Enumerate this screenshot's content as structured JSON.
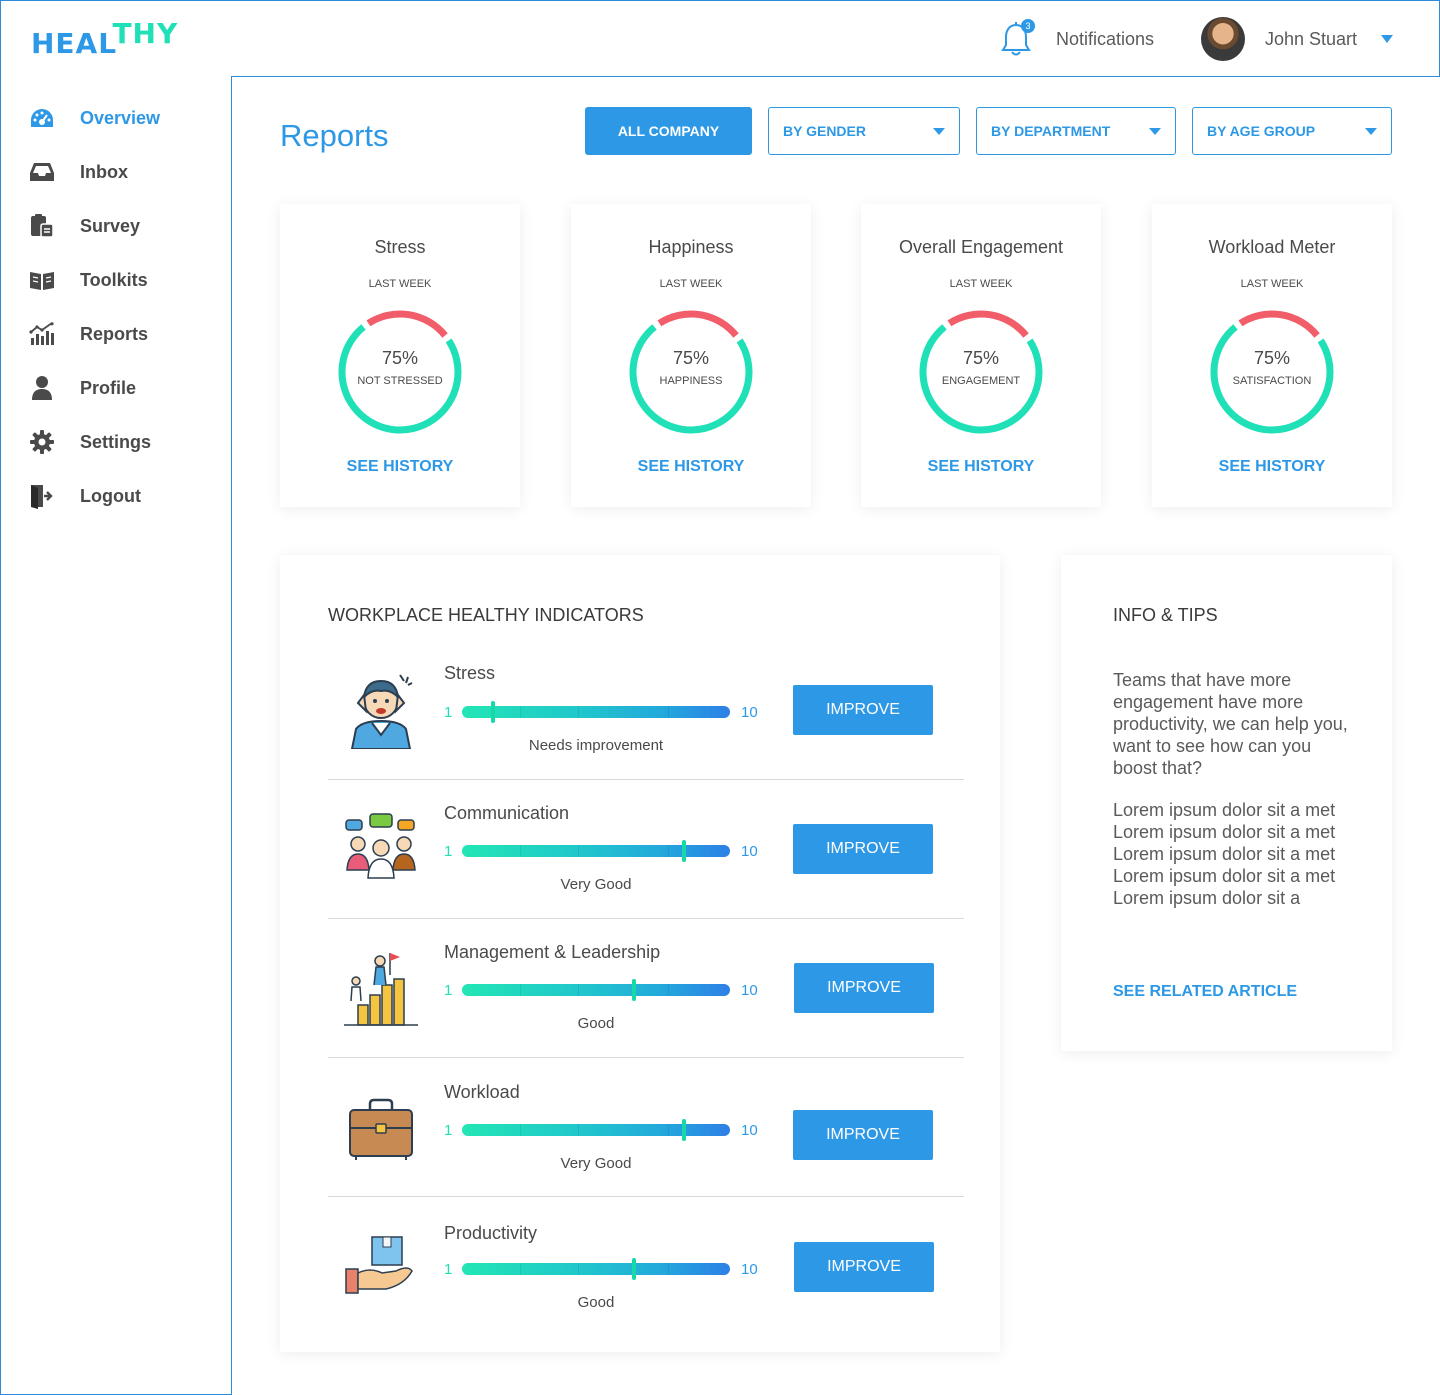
{
  "header": {
    "logo_part1": "HEAL",
    "logo_part2": "THY",
    "notification_count": "3",
    "notifications_label": "Notifications",
    "user_name": "John Stuart"
  },
  "colors": {
    "accent": "#2d98e6",
    "teal": "#1fe0b6",
    "gauge_red": "#f25d6a"
  },
  "sidebar": {
    "items": [
      {
        "label": "Overview",
        "icon": "dashboard-icon",
        "active": true
      },
      {
        "label": "Inbox",
        "icon": "inbox-icon"
      },
      {
        "label": "Survey",
        "icon": "clipboard-icon"
      },
      {
        "label": "Toolkits",
        "icon": "book-icon"
      },
      {
        "label": "Reports",
        "icon": "bar-chart-icon"
      },
      {
        "label": "Profile",
        "icon": "user-icon"
      },
      {
        "label": "Settings",
        "icon": "gear-icon"
      },
      {
        "label": "Logout",
        "icon": "logout-icon"
      }
    ]
  },
  "main": {
    "title": "Reports",
    "filters": [
      {
        "label": "ALL COMPANY",
        "selected": true
      },
      {
        "label": "BY GENDER"
      },
      {
        "label": "BY DEPARTMENT"
      },
      {
        "label": "BY AGE GROUP"
      }
    ],
    "metrics": [
      {
        "title": "Stress",
        "period": "LAST WEEK",
        "value": "75%",
        "percent": 75,
        "caption": "NOT STRESSED",
        "link": "SEE HISTORY"
      },
      {
        "title": "Happiness",
        "period": "LAST WEEK",
        "value": "75%",
        "percent": 75,
        "caption": "HAPPINESS",
        "link": "SEE HISTORY"
      },
      {
        "title": "Overall Engagement",
        "period": "LAST WEEK",
        "value": "75%",
        "percent": 75,
        "caption": "ENGAGEMENT",
        "link": "SEE HISTORY"
      },
      {
        "title": "Workload Meter",
        "period": "LAST WEEK",
        "value": "75%",
        "percent": 75,
        "caption": "SATISFACTION",
        "link": "SEE HISTORY"
      }
    ],
    "indicators": {
      "title": "WORKPLACE HEALTHY INDICATORS",
      "rows": [
        {
          "name": "Stress",
          "icon": "stressed-person-icon",
          "min": "1",
          "max": "10",
          "score": 2,
          "status": "Needs improvement",
          "button": "IMPROVE"
        },
        {
          "name": "Communication",
          "icon": "team-chat-icon",
          "min": "1",
          "max": "10",
          "score": 8.5,
          "status": "Very Good",
          "button": "IMPROVE"
        },
        {
          "name": "Management & Leadership",
          "icon": "leadership-icon",
          "min": "1",
          "max": "10",
          "score": 6.8,
          "status": "Good",
          "button": "IMPROVE"
        },
        {
          "name": "Workload",
          "icon": "briefcase-icon",
          "min": "1",
          "max": "10",
          "score": 8.5,
          "status": "Very Good",
          "button": "IMPROVE"
        },
        {
          "name": "Productivity",
          "icon": "box-in-hand-icon",
          "min": "1",
          "max": "10",
          "score": 6.8,
          "status": "Good",
          "button": "IMPROVE"
        }
      ]
    },
    "tips": {
      "title": "INFO & TIPS",
      "paragraph1": "Teams that have more engagement have more productivity, we can help you, want to see how can you boost that?",
      "paragraph2": "Lorem ipsum dolor sit a met Lorem ipsum dolor sit a met Lorem ipsum dolor sit a met Lorem ipsum dolor sit a met Lorem ipsum dolor sit a",
      "link": "SEE RELATED ARTICLE"
    }
  }
}
